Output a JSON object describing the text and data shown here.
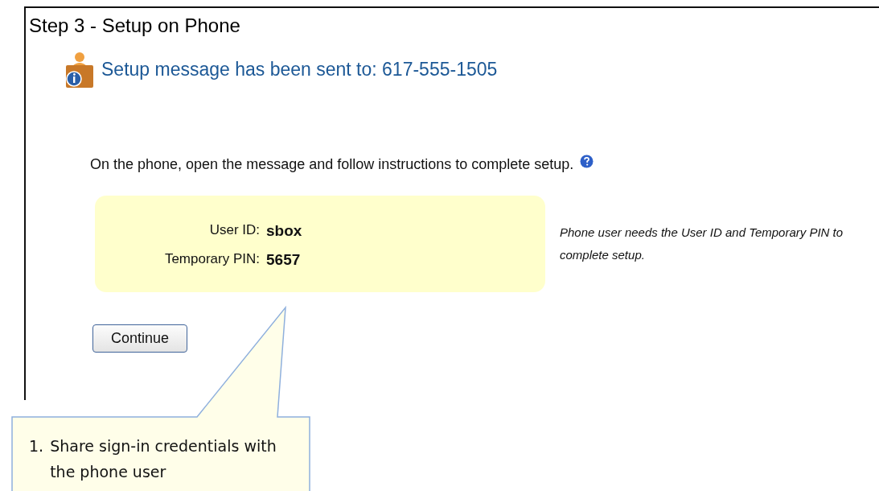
{
  "title": "Step 3 - Setup on Phone",
  "status_message": "Setup message has been sent to: 617-555-1505",
  "instruction": "On the phone, open the message and follow instructions to complete setup.",
  "credentials": [
    {
      "label": "User ID:",
      "value": "sbox"
    },
    {
      "label": "Temporary PIN:",
      "value": "5657"
    }
  ],
  "note": "Phone user needs the User ID and Temporary PIN to complete setup.",
  "buttons": [
    "Continue"
  ],
  "callout": {
    "number": "1.",
    "text": "Share sign-in credentials with the phone user"
  }
}
